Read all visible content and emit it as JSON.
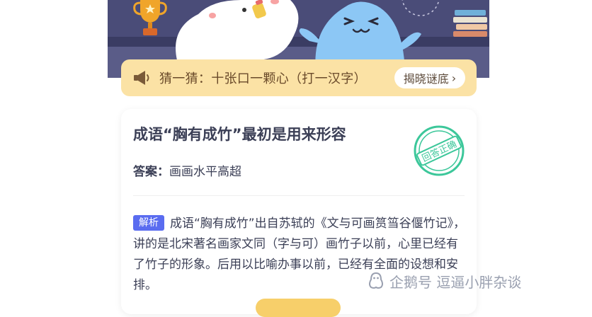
{
  "riddle": {
    "text": "猜一猜：十张口一颗心（打一汉字）",
    "reveal_label": "揭晓谜底",
    "icon": "megaphone-icon"
  },
  "question": {
    "title": "成语“胸有成竹”最初是用来形容",
    "answer_label": "答案：",
    "answer_value": "画画水平高超",
    "stamp_text": "回答正确"
  },
  "explanation": {
    "tag": "解析",
    "text": "成语“胸有成竹”出自苏轼的《文与可画筼筜谷偃竹记》，讲的是北宋著名画家文同（字与可）画竹子以前，心里已经有了竹子的形象。后用以比喻办事以前，已经有全面的设想和安排。"
  },
  "watermark": {
    "text": "企鹅号 逗逼小胖杂谈",
    "icon": "penguin-logo-icon"
  },
  "colors": {
    "banner_bg": "#4a4c78",
    "riddle_bg": "#fbe2a5",
    "tag_bg": "#5a6cf0",
    "stamp": "#3cc79a"
  }
}
